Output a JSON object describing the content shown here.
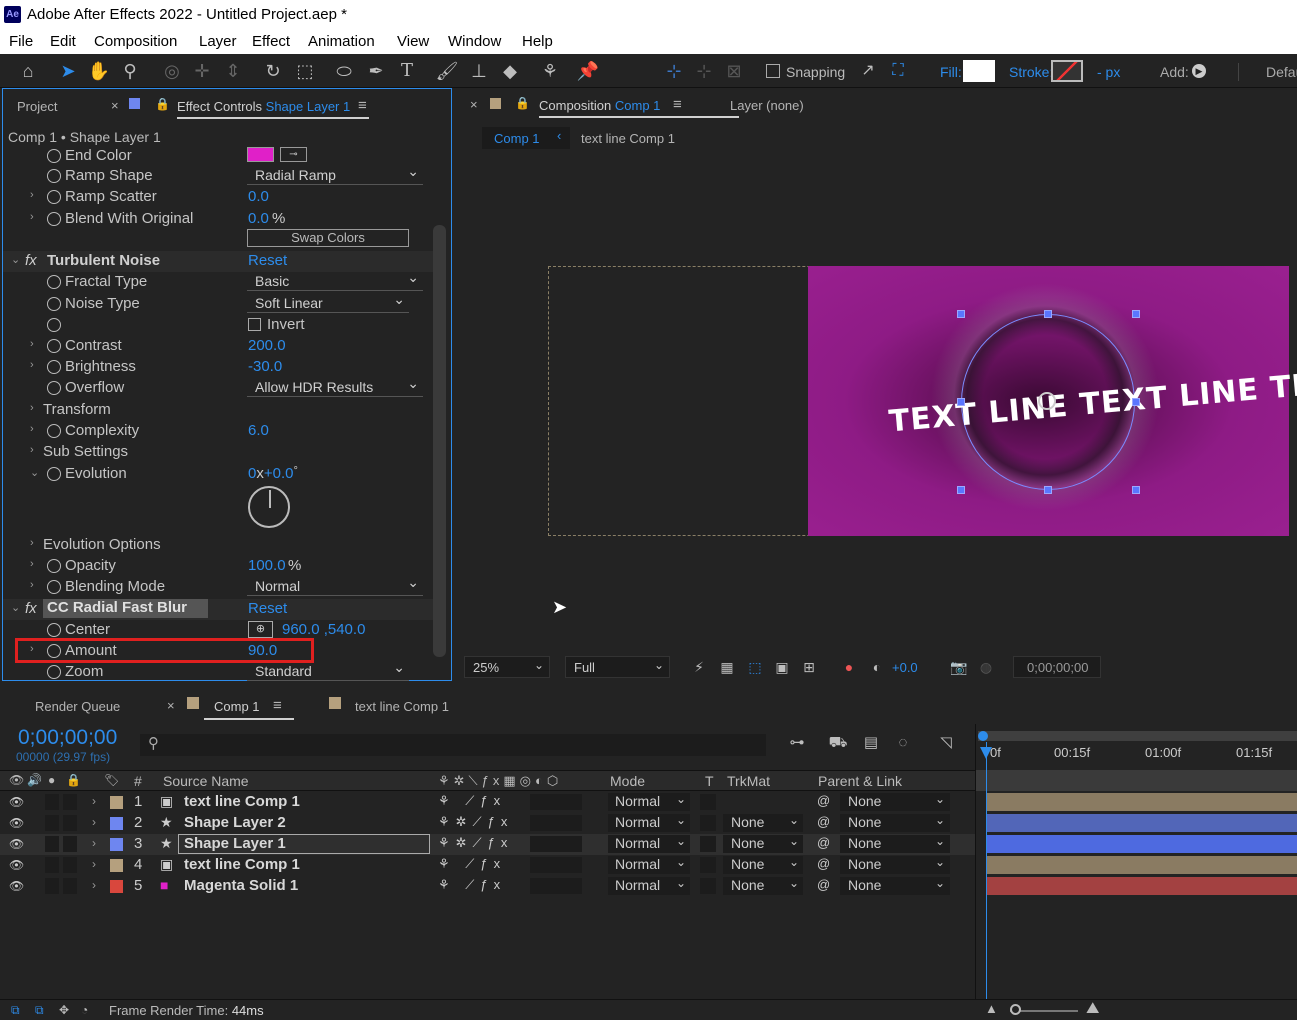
{
  "window": {
    "title": "Adobe After Effects 2022 - Untitled Project.aep *",
    "logo": "Ae"
  },
  "menu": [
    "File",
    "Edit",
    "Composition",
    "Layer",
    "Effect",
    "Animation",
    "View",
    "Window",
    "Help"
  ],
  "toolbar": {
    "snapping": "Snapping",
    "fill": "Fill:",
    "stroke": "Stroke:",
    "px": "- px",
    "add": "Add:",
    "workspace": "Defau"
  },
  "left_panel": {
    "tab_project": "Project",
    "tab_ec": "Effect Controls",
    "tab_ec_layer": "Shape Layer 1",
    "breadcrumb": "Comp 1 • Shape Layer 1",
    "end_color": "End Color",
    "ramp_shape": "Ramp Shape",
    "ramp_shape_val": "Radial Ramp",
    "ramp_scatter": "Ramp Scatter",
    "ramp_scatter_val": "0.0",
    "blend": "Blend With Original",
    "blend_val": "0.0",
    "blend_unit": "%",
    "swap": "Swap Colors",
    "tn": "Turbulent Noise",
    "reset": "Reset",
    "fractal": "Fractal Type",
    "fractal_val": "Basic",
    "noise": "Noise Type",
    "noise_val": "Soft Linear",
    "invert": "Invert",
    "contrast": "Contrast",
    "contrast_val": "200.0",
    "brightness": "Brightness",
    "brightness_val": "-30.0",
    "overflow": "Overflow",
    "overflow_val": "Allow HDR Results",
    "transform": "Transform",
    "complexity": "Complexity",
    "complexity_val": "6.0",
    "sub": "Sub Settings",
    "evolution": "Evolution",
    "evo_rev": "0",
    "evo_x": "x",
    "evo_deg": "+0.0",
    "evo_unit": "°",
    "evo_opts": "Evolution Options",
    "opacity": "Opacity",
    "opacity_val": "100.0",
    "opacity_unit": "%",
    "blending": "Blending Mode",
    "blending_val": "Normal",
    "ccrfb": "CC Radial Fast Blur",
    "center": "Center",
    "center_val": "960.0 ,540.0",
    "amount": "Amount",
    "amount_val": "90.0",
    "zoom": "Zoom",
    "zoom_val": "Standard"
  },
  "comp_panel": {
    "tab": "Composition",
    "tab_comp": "Comp 1",
    "layer_tab": "Layer (none)",
    "crumb1": "Comp 1",
    "crumb2": "text line Comp 1",
    "overlay_text": "TEXT LINE TEXT LINE TEXT LINE",
    "zoom": "25%",
    "res": "Full",
    "exposure": "+0.0",
    "timecode": "0;00;00;00"
  },
  "timeline": {
    "tab_rq": "Render Queue",
    "tab_comp": "Comp 1",
    "tab_tl": "text line Comp 1",
    "timecode": "0;00;00;00",
    "fps": "00000 (29.97 fps)",
    "headers": {
      "hash": "#",
      "source": "Source Name",
      "mode": "Mode",
      "t": "T",
      "trkmat": "TrkMat",
      "parent": "Parent & Link"
    },
    "ruler": [
      "0f",
      "00:15f",
      "01:00f",
      "01:15f"
    ],
    "layers": [
      {
        "num": "1",
        "name": "text line Comp 1",
        "mode": "Normal",
        "trk": "",
        "parent": "None",
        "label": "#b5a07e",
        "bar": "#8a7b62",
        "type": "comp"
      },
      {
        "num": "2",
        "name": "Shape Layer 2",
        "mode": "Normal",
        "trk": "None",
        "parent": "None",
        "label": "#6e86f0",
        "bar": "#5266b8",
        "type": "shape"
      },
      {
        "num": "3",
        "name": "Shape Layer 1",
        "mode": "Normal",
        "trk": "None",
        "parent": "None",
        "label": "#6e86f0",
        "bar": "#4e6ae0",
        "type": "shape"
      },
      {
        "num": "4",
        "name": "text line Comp 1",
        "mode": "Normal",
        "trk": "None",
        "parent": "None",
        "label": "#b5a07e",
        "bar": "#8a7b62",
        "type": "comp"
      },
      {
        "num": "5",
        "name": "Magenta Solid 1",
        "mode": "Normal",
        "trk": "None",
        "parent": "None",
        "label": "#d9473d",
        "bar": "#a34141",
        "type": "solid"
      }
    ]
  },
  "status": {
    "label": "Frame Render Time:",
    "value": "44ms"
  }
}
